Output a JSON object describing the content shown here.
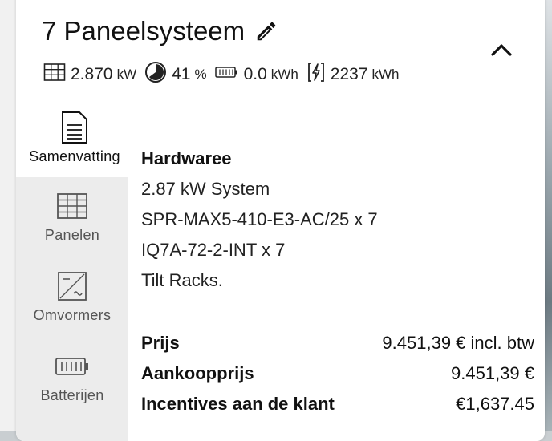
{
  "header": {
    "title": "7 Paneelsysteem",
    "stats": [
      {
        "icon": "solar-panel-icon",
        "value": "2.870",
        "unit": "kW"
      },
      {
        "icon": "offset-gauge-icon",
        "value": "41",
        "unit": "%"
      },
      {
        "icon": "battery-icon",
        "value": "0.0",
        "unit": "kWh"
      },
      {
        "icon": "energy-icon",
        "value": "2237",
        "unit": "kWh"
      }
    ]
  },
  "tabs": [
    {
      "label": "Samenvatting",
      "icon": "document-icon",
      "active": true
    },
    {
      "label": "Panelen",
      "icon": "panel-grid-icon",
      "active": false
    },
    {
      "label": "Omvormers",
      "icon": "inverter-icon",
      "active": false
    },
    {
      "label": "Batterijen",
      "icon": "battery-icon",
      "active": false
    }
  ],
  "summary": {
    "hardware_title": "Hardwaree",
    "hardware_lines": [
      "2.87 kW System",
      "SPR-MAX5-410-E3-AC/25 x 7",
      "IQ7A-72-2-INT x 7",
      "Tilt Racks."
    ],
    "pricing": [
      {
        "label": "Prijs",
        "value": "9.451,39 € incl. btw"
      },
      {
        "label": "Aankoopprijs",
        "value": "9.451,39 €"
      },
      {
        "label": "Incentives aan de klant",
        "value": "€1,637.45"
      }
    ]
  }
}
